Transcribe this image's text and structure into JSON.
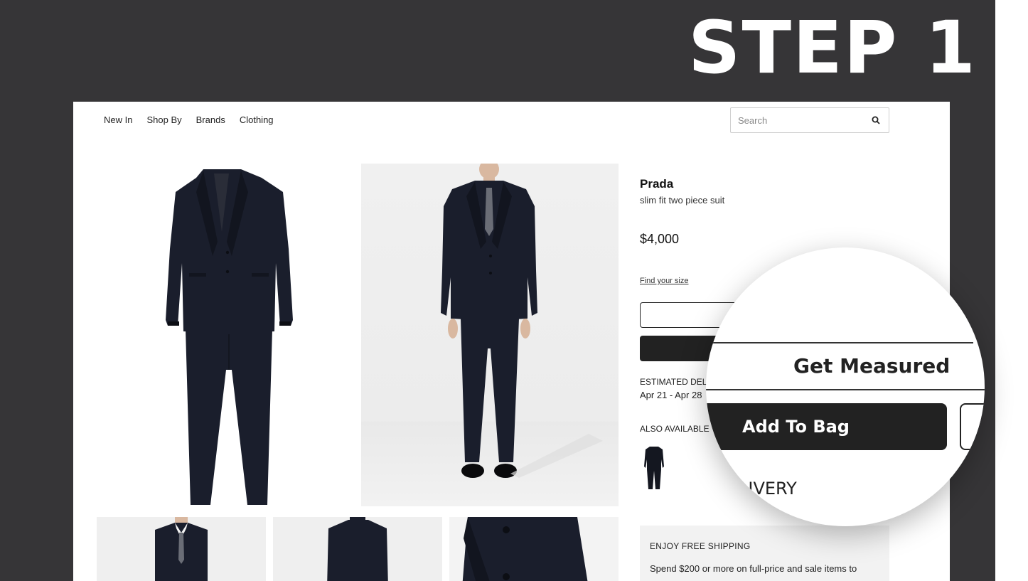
{
  "overlay": {
    "step_title": "STEP 1"
  },
  "nav": {
    "items": [
      "New In",
      "Shop By",
      "Brands",
      "Clothing"
    ]
  },
  "search": {
    "placeholder": "Search",
    "icon": "search-icon"
  },
  "product": {
    "brand": "Prada",
    "name": "slim fit two piece suit",
    "price": "$4,000",
    "find_size_label": "Find your size",
    "add_button_label_partial": "Ad",
    "estimated_delivery_label": "ESTIMATED DEL",
    "estimated_delivery_dates": "Apr 21 - Apr 28",
    "also_available_label": "ALSO AVAILABLE"
  },
  "shipping": {
    "title": "ENJOY FREE SHIPPING",
    "text": "Spend $200 or more on full-price and sale items to"
  },
  "magnifier": {
    "get_measured_label": "Get Measured",
    "add_to_bag_label": "Add To Bag",
    "delivery_fragment": "LIVERY"
  },
  "colors": {
    "background_dark": "#363537",
    "button_dark": "#222222",
    "suit_navy": "#1a1e2c"
  }
}
